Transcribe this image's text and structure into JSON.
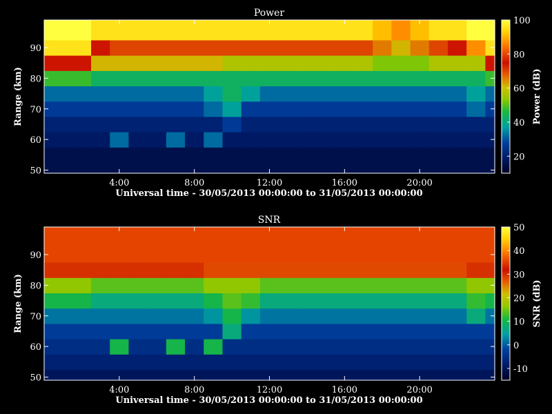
{
  "chart_data": [
    {
      "type": "heatmap",
      "title": "Power",
      "xlabel": "Universal time - 30/05/2013 00:00:00 to 31/05/2013 00:00:00",
      "ylabel": "Range (km)",
      "xlim": [
        0,
        24
      ],
      "ylim": [
        49,
        99
      ],
      "x_ticks": [
        4,
        8,
        12,
        16,
        20
      ],
      "x_tick_labels": [
        "4:00",
        "8:00",
        "12:00",
        "16:00",
        "20:00"
      ],
      "y_ticks": [
        50,
        60,
        70,
        80,
        90
      ],
      "y_tick_labels": [
        "50",
        "60",
        "70",
        "80",
        "90"
      ],
      "colorbar": {
        "label": "Power (dB)",
        "range": [
          10,
          100
        ],
        "ticks": [
          20,
          40,
          60,
          80,
          100
        ],
        "tick_labels": [
          "20",
          "40",
          "60",
          "80",
          "100"
        ]
      },
      "colormap": [
        "#000020",
        "#001a66",
        "#0040a0",
        "#00a0a0",
        "#18b840",
        "#8cc800",
        "#d0c000",
        "#e66000",
        "#cc1000",
        "#ff8000",
        "#ffd000",
        "#ffff40"
      ],
      "x_hours": [
        0,
        1,
        2,
        3,
        4,
        5,
        6,
        7,
        8,
        9,
        10,
        11,
        12,
        13,
        14,
        15,
        16,
        17,
        18,
        19,
        20,
        21,
        22,
        23,
        24
      ],
      "y_km": [
        50,
        55,
        60,
        65,
        70,
        75,
        80,
        85,
        90,
        95
      ],
      "values": [
        [
          15,
          15,
          15,
          15,
          15,
          15,
          15,
          15,
          15,
          15,
          15,
          15,
          15,
          15,
          15,
          15,
          15,
          15,
          15,
          15,
          15,
          15,
          15,
          15,
          15
        ],
        [
          15,
          15,
          15,
          15,
          15,
          15,
          15,
          15,
          15,
          15,
          15,
          15,
          15,
          15,
          15,
          15,
          15,
          15,
          15,
          15,
          15,
          15,
          15,
          15,
          15
        ],
        [
          18,
          18,
          18,
          18,
          30,
          18,
          18,
          30,
          18,
          30,
          18,
          18,
          18,
          18,
          18,
          18,
          18,
          18,
          18,
          18,
          18,
          18,
          18,
          18,
          18
        ],
        [
          20,
          20,
          20,
          20,
          20,
          20,
          20,
          20,
          20,
          20,
          25,
          20,
          20,
          20,
          20,
          20,
          20,
          20,
          20,
          20,
          20,
          20,
          20,
          20,
          20
        ],
        [
          25,
          25,
          25,
          25,
          25,
          25,
          25,
          25,
          25,
          30,
          35,
          25,
          25,
          25,
          25,
          25,
          25,
          25,
          25,
          25,
          25,
          25,
          25,
          30,
          25
        ],
        [
          30,
          30,
          30,
          30,
          30,
          30,
          30,
          30,
          30,
          35,
          40,
          35,
          30,
          30,
          30,
          30,
          30,
          30,
          30,
          30,
          30,
          30,
          30,
          35,
          30
        ],
        [
          45,
          45,
          45,
          40,
          40,
          40,
          40,
          40,
          40,
          40,
          40,
          40,
          40,
          40,
          40,
          40,
          40,
          40,
          40,
          40,
          40,
          40,
          40,
          40,
          45
        ],
        [
          75,
          75,
          75,
          60,
          60,
          60,
          60,
          60,
          60,
          60,
          55,
          55,
          55,
          55,
          55,
          55,
          55,
          55,
          50,
          50,
          50,
          55,
          55,
          55,
          75
        ],
        [
          95,
          95,
          95,
          75,
          70,
          70,
          70,
          70,
          70,
          70,
          70,
          70,
          70,
          70,
          70,
          70,
          70,
          70,
          65,
          60,
          65,
          70,
          75,
          85,
          95
        ],
        [
          100,
          100,
          100,
          95,
          95,
          95,
          95,
          95,
          95,
          95,
          95,
          95,
          95,
          95,
          95,
          95,
          95,
          95,
          90,
          85,
          90,
          95,
          95,
          100,
          100
        ]
      ]
    },
    {
      "type": "heatmap",
      "title": "SNR",
      "xlabel": "Universal time - 30/05/2013 00:00:00 to 31/05/2013 00:00:00",
      "ylabel": "Range (km)",
      "xlim": [
        0,
        24
      ],
      "ylim": [
        49,
        99
      ],
      "x_ticks": [
        4,
        8,
        12,
        16,
        20
      ],
      "x_tick_labels": [
        "4:00",
        "8:00",
        "12:00",
        "16:00",
        "20:00"
      ],
      "y_ticks": [
        50,
        60,
        70,
        80,
        90
      ],
      "y_tick_labels": [
        "50",
        "60",
        "70",
        "80",
        "90"
      ],
      "colorbar": {
        "label": "SNR (dB)",
        "range": [
          -15,
          50
        ],
        "ticks": [
          -10,
          0,
          10,
          20,
          30,
          40,
          50
        ],
        "tick_labels": [
          "-10",
          "0",
          "10",
          "20",
          "30",
          "40",
          "50"
        ]
      },
      "colormap": [
        "#000020",
        "#001a66",
        "#0040a0",
        "#00a0a0",
        "#18b840",
        "#8cc800",
        "#d0c000",
        "#e66000",
        "#cc1000",
        "#ff8000",
        "#ffd000",
        "#ffff40"
      ],
      "x_hours": [
        0,
        1,
        2,
        3,
        4,
        5,
        6,
        7,
        8,
        9,
        10,
        11,
        12,
        13,
        14,
        15,
        16,
        17,
        18,
        19,
        20,
        21,
        22,
        23,
        24
      ],
      "y_km": [
        50,
        55,
        60,
        65,
        70,
        75,
        80,
        85,
        90,
        95
      ],
      "values": [
        [
          -10,
          -10,
          -10,
          -10,
          -10,
          -10,
          -10,
          -10,
          -10,
          -10,
          -10,
          -10,
          -10,
          -10,
          -10,
          -10,
          -10,
          -10,
          -10,
          -10,
          -10,
          -10,
          -10,
          -10,
          -10
        ],
        [
          -8,
          -8,
          -8,
          -8,
          -8,
          -8,
          -8,
          -8,
          -8,
          -8,
          -8,
          -8,
          -8,
          -8,
          -8,
          -8,
          -8,
          -8,
          -8,
          -8,
          -8,
          -8,
          -8,
          -8,
          -8
        ],
        [
          -6,
          -6,
          -6,
          -6,
          8,
          -6,
          -6,
          8,
          -6,
          8,
          -6,
          -6,
          -6,
          -6,
          -6,
          -6,
          -6,
          -6,
          -6,
          -6,
          -6,
          -6,
          -6,
          -6,
          -6
        ],
        [
          -4,
          -4,
          -4,
          -4,
          -4,
          -4,
          -4,
          -4,
          -4,
          -4,
          5,
          -4,
          -4,
          -4,
          -4,
          -4,
          -4,
          -4,
          -4,
          -4,
          -4,
          -4,
          -4,
          -4,
          -4
        ],
        [
          0,
          0,
          0,
          0,
          0,
          0,
          0,
          0,
          0,
          2,
          8,
          2,
          0,
          0,
          0,
          0,
          0,
          0,
          0,
          0,
          0,
          0,
          0,
          5,
          0
        ],
        [
          8,
          8,
          8,
          5,
          5,
          5,
          5,
          5,
          5,
          8,
          12,
          10,
          5,
          5,
          5,
          5,
          5,
          5,
          5,
          5,
          5,
          5,
          5,
          10,
          8
        ],
        [
          15,
          15,
          15,
          12,
          12,
          12,
          12,
          12,
          12,
          15,
          15,
          15,
          12,
          12,
          12,
          12,
          12,
          12,
          12,
          12,
          12,
          12,
          12,
          15,
          15
        ],
        [
          30,
          30,
          30,
          30,
          30,
          30,
          30,
          30,
          30,
          28,
          28,
          28,
          28,
          28,
          28,
          28,
          28,
          28,
          28,
          28,
          28,
          28,
          28,
          30,
          30
        ],
        [
          35,
          35,
          35,
          35,
          35,
          35,
          35,
          35,
          35,
          35,
          35,
          35,
          35,
          35,
          35,
          35,
          35,
          35,
          35,
          35,
          35,
          35,
          35,
          35,
          35
        ],
        [
          35,
          35,
          35,
          35,
          35,
          35,
          35,
          35,
          35,
          35,
          35,
          35,
          35,
          35,
          35,
          35,
          35,
          35,
          35,
          35,
          35,
          35,
          35,
          35,
          35
        ]
      ]
    }
  ]
}
